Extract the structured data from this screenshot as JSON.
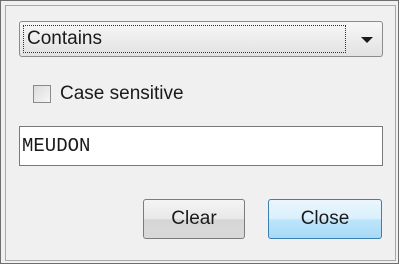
{
  "filter": {
    "mode_selected": "Contains",
    "case_sensitive_label": "Case sensitive",
    "case_sensitive_checked": false,
    "search_value": "MEUDON"
  },
  "buttons": {
    "clear_label": "Clear",
    "close_label": "Close"
  }
}
